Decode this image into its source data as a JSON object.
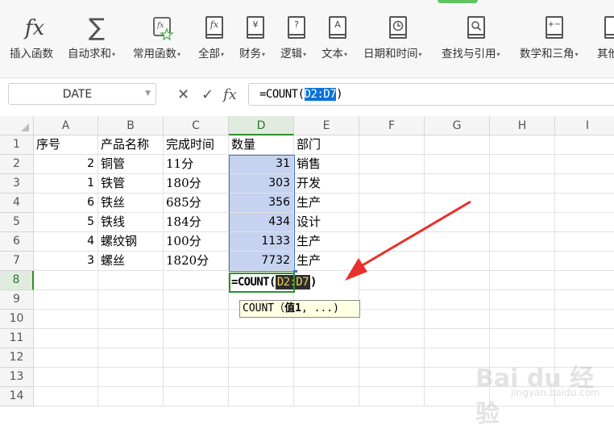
{
  "ribbon": {
    "buttons": [
      {
        "label": "插入函数",
        "dropdown": false,
        "icon": "fx-icon"
      },
      {
        "label": "自动求和",
        "dropdown": true,
        "icon": "sigma-icon"
      },
      {
        "label": "常用函数",
        "dropdown": true,
        "icon": "star-function-icon"
      },
      {
        "label": "全部",
        "dropdown": true,
        "icon": "fx-book-icon"
      },
      {
        "label": "财务",
        "dropdown": true,
        "icon": "yen-book-icon"
      },
      {
        "label": "逻辑",
        "dropdown": true,
        "icon": "question-book-icon"
      },
      {
        "label": "文本",
        "dropdown": true,
        "icon": "text-book-icon"
      },
      {
        "label": "日期和时间",
        "dropdown": true,
        "icon": "clock-book-icon"
      },
      {
        "label": "查找与引用",
        "dropdown": true,
        "icon": "search-book-icon"
      },
      {
        "label": "数学和三角",
        "dropdown": true,
        "icon": "math-book-icon"
      },
      {
        "label": "其他",
        "dropdown": false,
        "icon": "more-book-icon"
      }
    ],
    "icon_glyphs": {
      "fx": "fx",
      "sigma": "∑",
      "yen": "¥",
      "question": "?",
      "text": "A",
      "math": "+−"
    },
    "accent_color": "#5fc45f"
  },
  "formula_bar": {
    "name_box": "DATE",
    "cancel": "✕",
    "confirm": "✓",
    "fx": "fx",
    "formula_prefix": "=COUNT(",
    "formula_ref": "D2:D7",
    "formula_suffix": ")"
  },
  "sheet": {
    "columns": [
      "A",
      "B",
      "C",
      "D",
      "E",
      "F",
      "G",
      "H",
      "I"
    ],
    "active_column": "D",
    "rows": [
      "1",
      "2",
      "3",
      "4",
      "5",
      "6",
      "7",
      "8",
      "9",
      "10",
      "11",
      "12",
      "13",
      "14"
    ],
    "active_row": "8",
    "header": [
      "序号",
      "产品名称",
      "完成时间",
      "数量",
      "部门"
    ],
    "data": [
      [
        "2",
        "铜管",
        "11分",
        "31",
        "销售"
      ],
      [
        "1",
        "铁管",
        "180分",
        "303",
        "开发"
      ],
      [
        "6",
        "铁丝",
        "685分",
        "356",
        "生产"
      ],
      [
        "5",
        "铁线",
        "184分",
        "434",
        "设计"
      ],
      [
        "4",
        "螺纹钢",
        "100分",
        "1133",
        "生产"
      ],
      [
        "3",
        "螺丝",
        "1820分",
        "7732",
        "生产"
      ]
    ],
    "editing_cell": {
      "prefix": "=COUNT(",
      "ref": "D2:D7",
      "suffix": ")"
    },
    "tooltip": {
      "func": "COUNT",
      "open": "（",
      "arg": "值1",
      "rest": ", ...)"
    },
    "selection_color": "#c6d3f0",
    "arrow_color": "#e8312a"
  },
  "watermark": {
    "brand": "Bai du 经验",
    "url": "jingyan.baidu.com"
  }
}
